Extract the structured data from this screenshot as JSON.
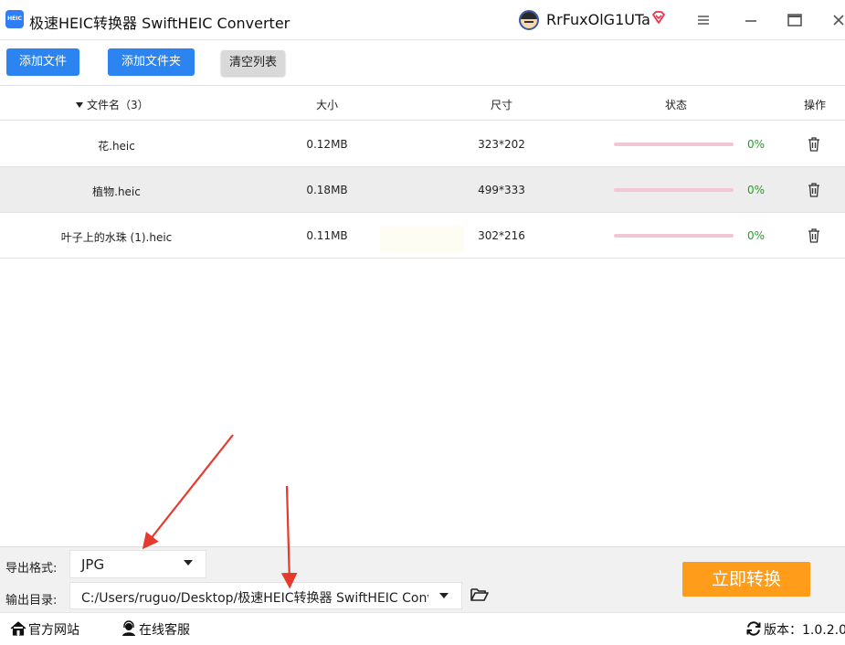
{
  "app": {
    "logo_text": "HEIC",
    "title": "极速HEIC转换器 SwiftHEIC Converter"
  },
  "user": {
    "name": "RrFuxOlG1UTa"
  },
  "colors": {
    "accent_blue": "#2b84f0",
    "convert_orange": "#ff9c1a",
    "progress_track": "#f2c6d2",
    "status_green": "#1aa51a",
    "vip_red": "#e8334a"
  },
  "toolbar": {
    "add_file": "添加文件",
    "add_folder": "添加文件夹",
    "clear_list": "清空列表"
  },
  "table": {
    "headers": {
      "name": "文件名（3）",
      "size": "大小",
      "dimensions": "尺寸",
      "status": "状态",
      "actions": "操作"
    },
    "rows": [
      {
        "name": "花.heic",
        "size": "0.12MB",
        "dimensions": "323*202",
        "progress": 0,
        "percent_label": "0%",
        "action_icon": "trash-icon"
      },
      {
        "name": "植物.heic",
        "size": "0.18MB",
        "dimensions": "499*333",
        "progress": 0,
        "percent_label": "0%",
        "action_icon": "trash-icon"
      },
      {
        "name": "叶子上的水珠 (1).heic",
        "size": "0.11MB",
        "dimensions": "302*216",
        "progress": 0,
        "percent_label": "0%",
        "action_icon": "trash-icon"
      }
    ]
  },
  "settings": {
    "format_label": "导出格式:",
    "format_value": "JPG",
    "dir_label": "输出目录:",
    "dir_value": "C:/Users/ruguo/Desktop/极速HEIC转换器 SwiftHEIC Converter"
  },
  "convert_button": "立即转换",
  "statusbar": {
    "website": "官方网站",
    "service": "在线客服",
    "version": "版本：1.0.2.0"
  }
}
